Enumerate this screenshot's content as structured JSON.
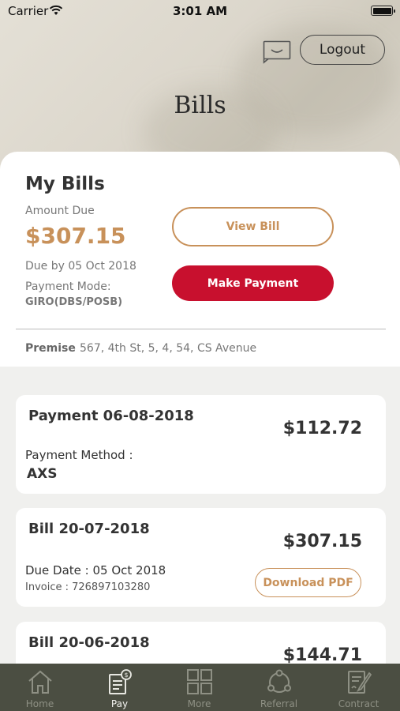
{
  "status_bar": {
    "carrier": "Carrier",
    "time": "3:01 AM"
  },
  "header": {
    "logout_label": "Logout",
    "title": "Bills"
  },
  "my_bills": {
    "title": "My Bills",
    "amount_due_label": "Amount Due",
    "amount_due": "$307.15",
    "due_by": "Due by 05 Oct 2018",
    "payment_mode_label": "Payment Mode:",
    "payment_mode_value": "GIRO(DBS/POSB)",
    "view_bill_label": "View Bill",
    "make_payment_label": "Make Payment",
    "premise_label": "Premise",
    "premise_value": "567, 4th St, 5, 4, 54, CS Avenue"
  },
  "transactions": [
    {
      "title": "Payment 06-08-2018",
      "amount": "$112.72",
      "method_label": "Payment Method :",
      "method_value": "AXS"
    },
    {
      "title": "Bill 20-07-2018",
      "amount": "$307.15",
      "due_date": "Due Date : 05 Oct 2018",
      "invoice": "Invoice : 726897103280",
      "download_label": "Download PDF"
    },
    {
      "title": "Bill 20-06-2018",
      "amount": "$144.71"
    }
  ],
  "tabs": [
    {
      "label": "Home",
      "icon": "home-icon"
    },
    {
      "label": "Pay",
      "icon": "pay-icon",
      "active": true
    },
    {
      "label": "More",
      "icon": "grid-icon"
    },
    {
      "label": "Referral",
      "icon": "share-icon"
    },
    {
      "label": "Contract",
      "icon": "contract-icon"
    }
  ],
  "colors": {
    "accent_gold": "#c8915a",
    "primary_red": "#c8102e",
    "tabbar_bg": "#4b4e42"
  }
}
